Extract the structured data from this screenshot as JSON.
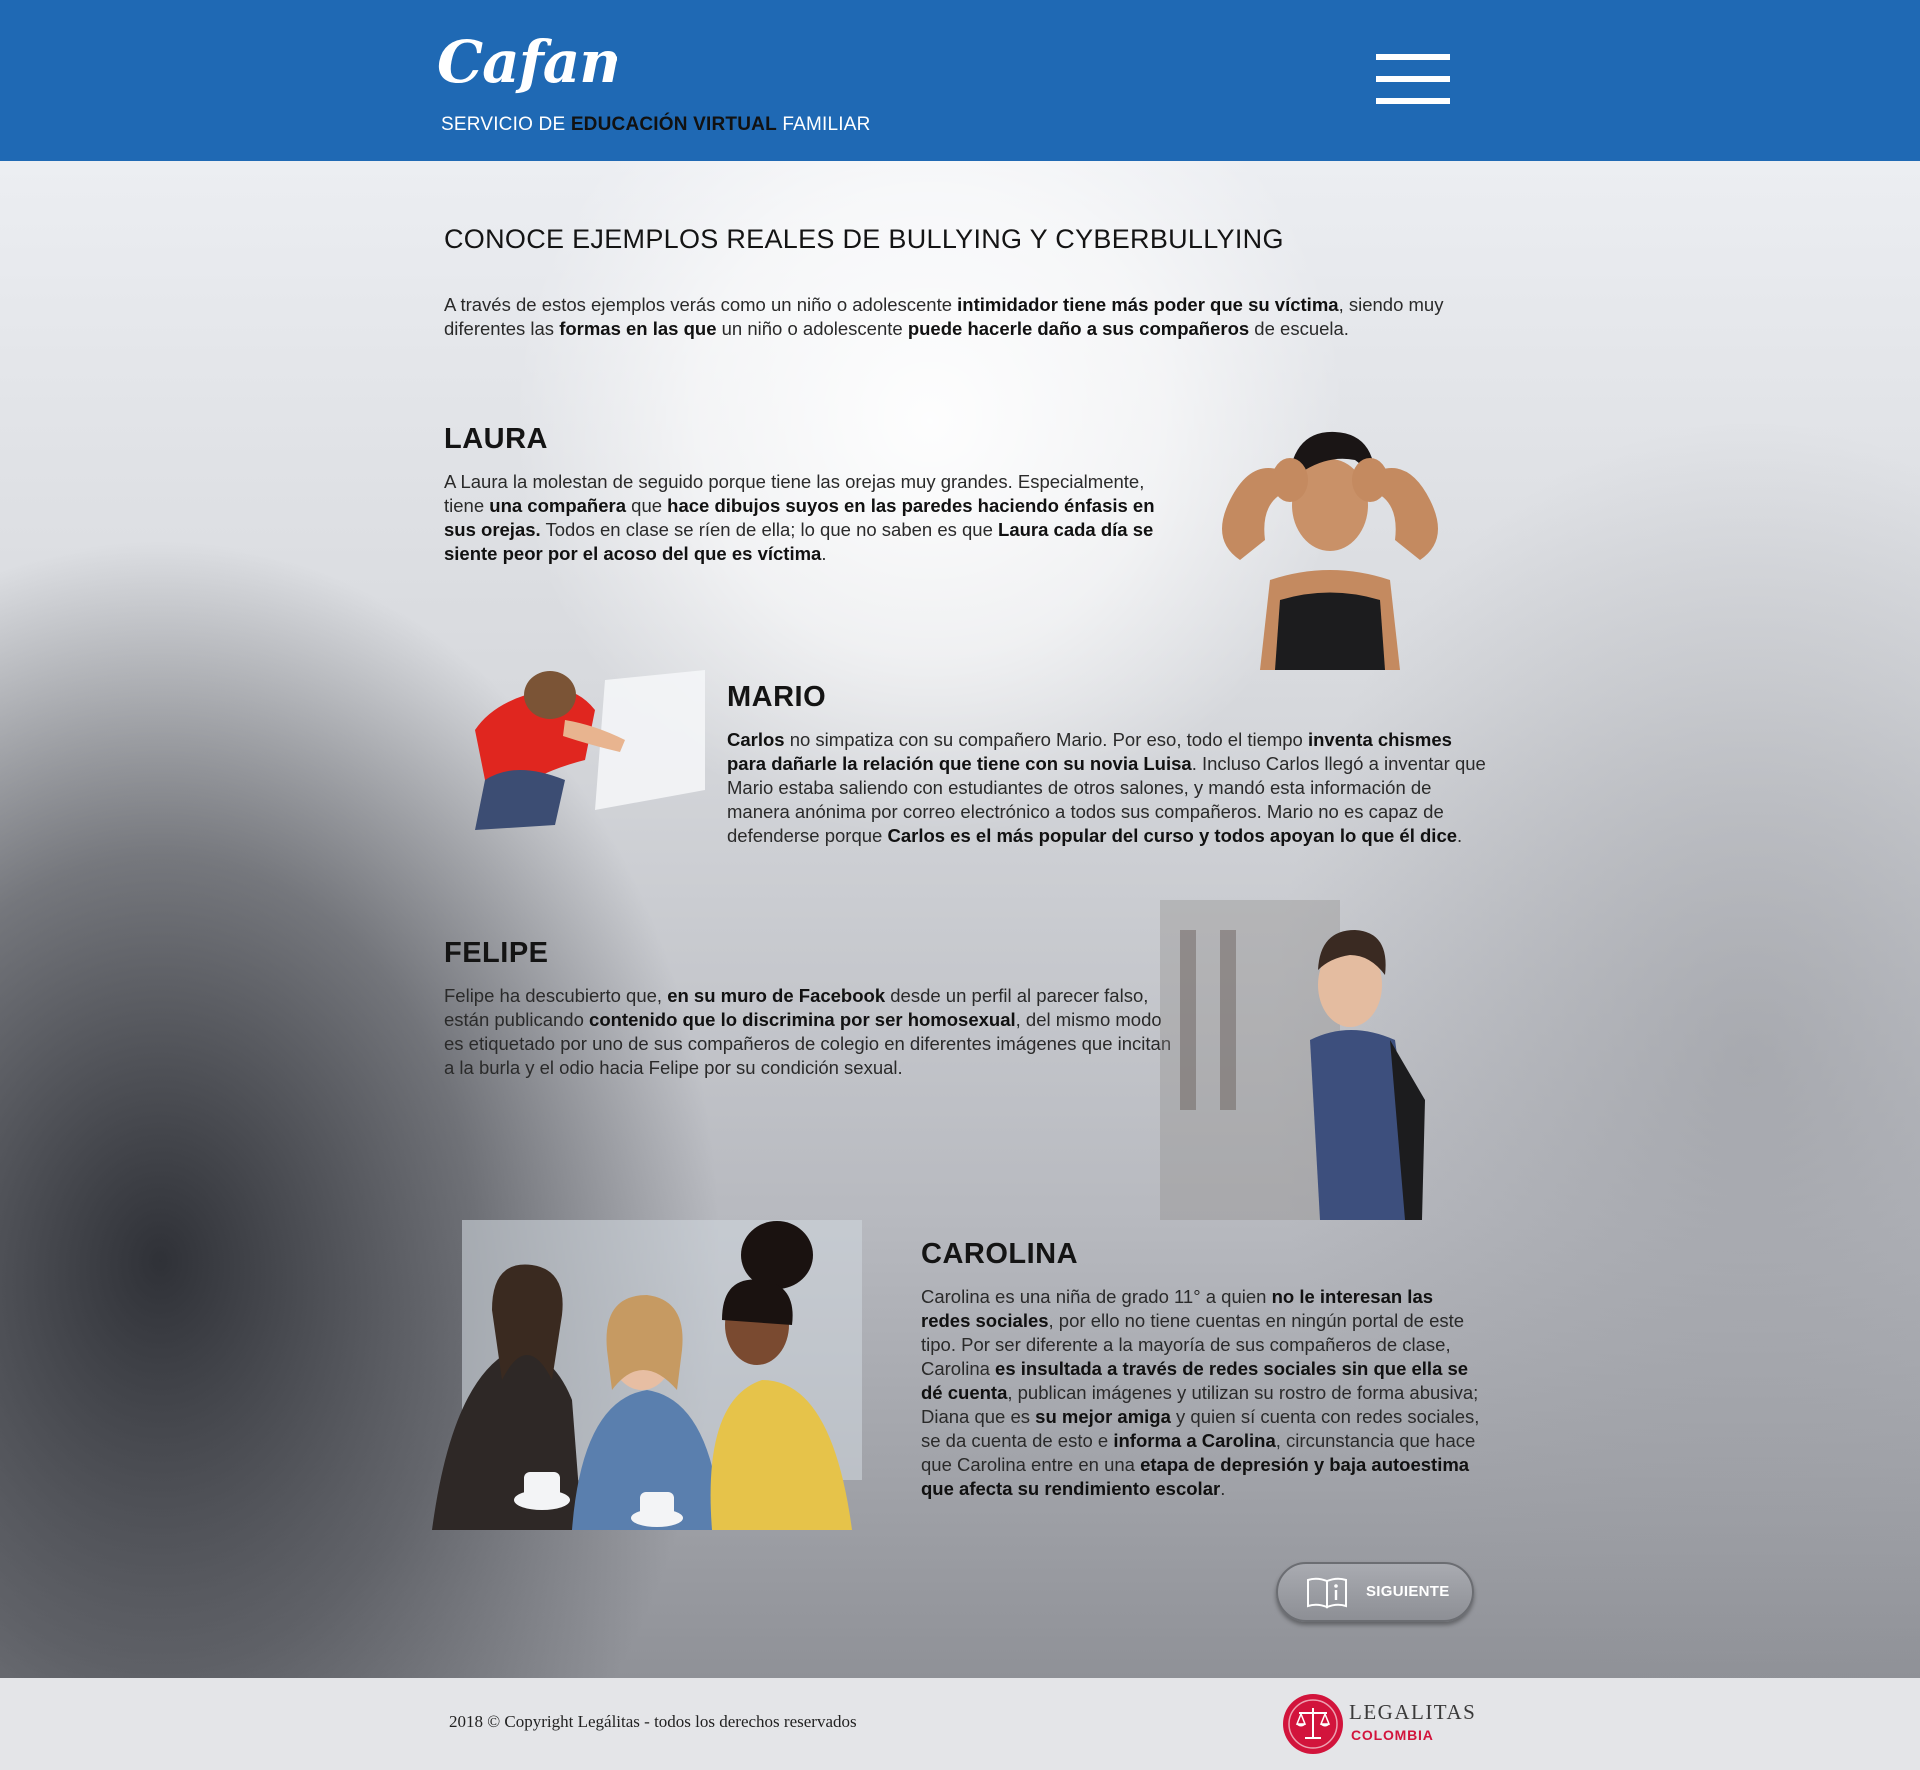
{
  "header": {
    "logo_text": "Cafam",
    "tagline_pre": "SERVICIO DE ",
    "tagline_bold": "EDUCACIÓN VIRTUAL",
    "tagline_post": " FAMILIAR",
    "menu_icon": "hamburger-menu-icon",
    "background_color": "#1f69b4"
  },
  "main": {
    "title": "CONOCE EJEMPLOS REALES DE BULLYING Y CYBERBULLYING",
    "intro": [
      {
        "t": "A través de estos ejemplos verás como un niño o adolescente ",
        "b": false
      },
      {
        "t": "intimidador tiene más poder que su víctima",
        "b": true
      },
      {
        "t": ", siendo muy diferentes las ",
        "b": false
      },
      {
        "t": "formas en las que",
        "b": true
      },
      {
        "t": " un niño o adolescente ",
        "b": false
      },
      {
        "t": "puede hacerle daño a sus compañeros",
        "b": true
      },
      {
        "t": " de escuela.",
        "b": false
      }
    ],
    "cases": [
      {
        "name": "LAURA",
        "body": [
          {
            "t": "A Laura la molestan de seguido porque tiene las orejas muy grandes. Especialmente, tiene ",
            "b": false
          },
          {
            "t": "una compañera",
            "b": true
          },
          {
            "t": " que ",
            "b": false
          },
          {
            "t": "hace dibujos suyos en las paredes haciendo énfasis en sus orejas.",
            "b": true
          },
          {
            "t": " Todos en clase se ríen de ella; lo que no saben es que ",
            "b": false
          },
          {
            "t": "Laura cada día se siente peor por el acoso del que es víctima",
            "b": true
          },
          {
            "t": ".",
            "b": false
          }
        ]
      },
      {
        "name": "MARIO",
        "body": [
          {
            "t": "Carlos",
            "b": true
          },
          {
            "t": " no simpatiza con su compañero Mario. Por eso, todo el tiempo ",
            "b": false
          },
          {
            "t": "inventa chismes para dañarle la relación que tiene con su novia Luisa",
            "b": true
          },
          {
            "t": ". Incluso Carlos llegó a inventar que Mario estaba saliendo con estudiantes de otros salones, y mandó esta información de manera anónima por correo electrónico a todos sus compañeros. Mario no es capaz de defenderse porque ",
            "b": false
          },
          {
            "t": "Carlos es el más popular del curso y todos apoyan lo que él dice",
            "b": true
          },
          {
            "t": ".",
            "b": false
          }
        ]
      },
      {
        "name": "FELIPE",
        "body": [
          {
            "t": "Felipe ha descubierto que, ",
            "b": false
          },
          {
            "t": "en su muro de Facebook",
            "b": true
          },
          {
            "t": " desde un perfil al parecer falso, están publicando ",
            "b": false
          },
          {
            "t": "contenido que lo discrimina por ser homosexual",
            "b": true
          },
          {
            "t": ", del mismo modo es etiquetado por uno de sus compañeros de colegio en diferentes imágenes que incitan a la burla y el odio hacia Felipe por su condición sexual.",
            "b": false
          }
        ]
      },
      {
        "name": "CAROLINA",
        "body": [
          {
            "t": "Carolina es una niña de grado 11° a quien ",
            "b": false
          },
          {
            "t": "no le interesan las redes sociales",
            "b": true
          },
          {
            "t": ", por ello no tiene cuentas en ningún portal de este tipo. Por ser diferente a la mayoría de sus compañeros de clase, Carolina ",
            "b": false
          },
          {
            "t": "es insultada a través de redes sociales sin que ella se dé cuenta",
            "b": true
          },
          {
            "t": ", publican imágenes y utilizan su rostro de forma abusiva; Diana que es ",
            "b": false
          },
          {
            "t": "su mejor amiga",
            "b": true
          },
          {
            "t": " y quien sí cuenta con redes sociales, se da cuenta de esto e ",
            "b": false
          },
          {
            "t": "informa a Carolina",
            "b": true
          },
          {
            "t": ", circunstancia que hace que Carolina entre en una ",
            "b": false
          },
          {
            "t": "etapa de depresión y baja autoestima que afecta su rendimiento escolar",
            "b": true
          },
          {
            "t": ".",
            "b": false
          }
        ]
      }
    ],
    "next_button": {
      "label": "SIGUIENTE",
      "icon": "book-info-icon"
    }
  },
  "footer": {
    "copyright": "2018 © Copyright Legálitas - todos los derechos reservados",
    "logo_name": "LEGALITAS",
    "logo_country": "COLOMBIA",
    "logo_icon": "scales-of-justice-icon",
    "brand_color": "#d2143c"
  }
}
